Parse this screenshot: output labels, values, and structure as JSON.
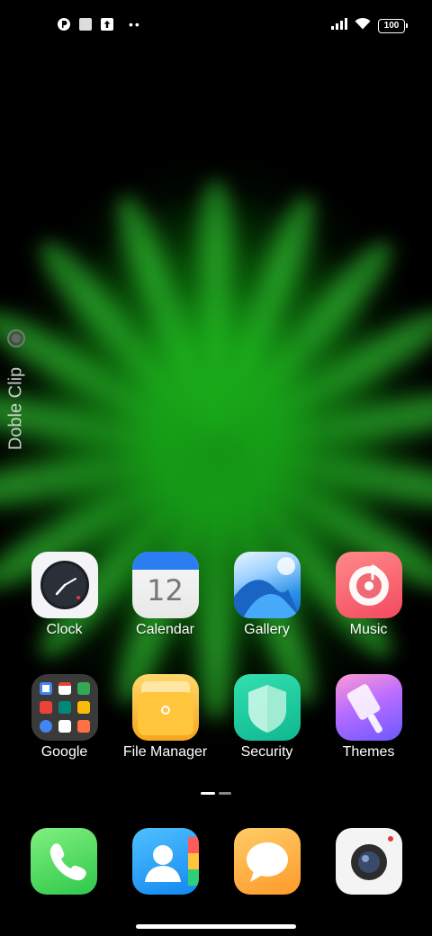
{
  "status_bar": {
    "left_icons": [
      "notification-app-icon",
      "square-notification-icon",
      "upload-icon",
      "more-dots-icon"
    ],
    "right_icons": [
      "signal-icon",
      "wifi-icon",
      "battery-icon"
    ],
    "battery_level": "100"
  },
  "side_widget": {
    "label": "Doble Clip"
  },
  "apps": [
    {
      "label": "Clock",
      "icon": "clock-icon"
    },
    {
      "label": "Calendar",
      "icon": "calendar-icon",
      "icon_text": "12"
    },
    {
      "label": "Gallery",
      "icon": "gallery-icon"
    },
    {
      "label": "Music",
      "icon": "music-icon"
    },
    {
      "label": "Google",
      "icon": "google-folder-icon"
    },
    {
      "label": "File Manager",
      "icon": "file-manager-icon"
    },
    {
      "label": "Security",
      "icon": "security-shield-icon"
    },
    {
      "label": "Themes",
      "icon": "themes-brush-icon"
    }
  ],
  "dock": [
    {
      "icon": "phone-icon"
    },
    {
      "icon": "contacts-icon"
    },
    {
      "icon": "messages-icon"
    },
    {
      "icon": "camera-icon"
    }
  ],
  "page_indicator": {
    "pages": 2,
    "current": 1
  },
  "colors": {
    "wallpaper_accent": "#1ed21e",
    "calendar_header": "#2b7ef2",
    "music_accent": "#f34a5f"
  }
}
